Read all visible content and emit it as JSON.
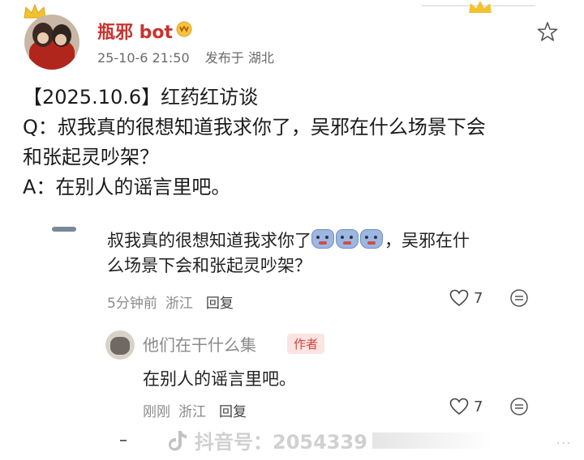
{
  "post": {
    "username": "瓶邪 bot",
    "date": "25-10-6 21:50",
    "location": "发布于 湖北",
    "lines": [
      "【2025.10.6】红药红访谈",
      "Q：叔我真的很想知道我求你了，吴邪在什么场景下会",
      "和张起灵吵架？",
      "A：在别人的谣言里吧。"
    ]
  },
  "comment": {
    "text_part1": "叔我真的很想知道我求你了",
    "text_part2": "，吴邪在什",
    "text_line2": "么场景下会和张起灵吵架？",
    "time": "5分钟前",
    "location": "浙江",
    "reply_label": "回复",
    "likes": "7"
  },
  "reply": {
    "name": "他们在干什么集",
    "author_tag": "作者",
    "text": "在别人的谣言里吧。",
    "time": "刚刚",
    "location": "浙江",
    "reply_label": "回复",
    "likes": "7"
  },
  "watermark": {
    "text": "抖音号：2054339"
  },
  "colors": {
    "username": "#c8332e",
    "author_tag": "#d3453d",
    "meta": "#8a8a8a"
  },
  "icons": [
    "crown-icon",
    "vip-badge-icon",
    "star-icon",
    "heart-icon",
    "more-icon",
    "douyin-logo-icon"
  ]
}
